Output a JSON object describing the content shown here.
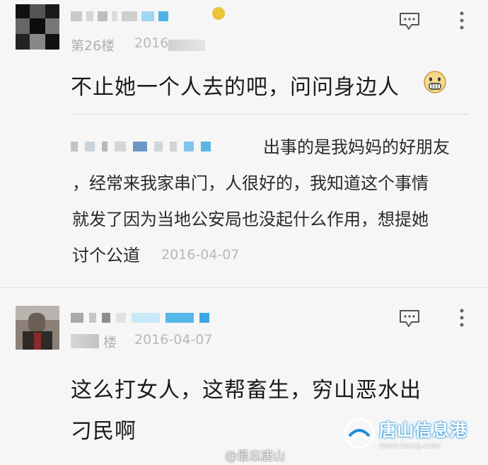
{
  "comment1": {
    "floor": "第26楼",
    "date_partial": "2016",
    "text": "不止她一个人去的吧，问问身边人",
    "emoji": "grimace-emoji"
  },
  "reply": {
    "text": "出事的是我妈妈的好朋友，经常来我家串门，人很好的，我知道这个事情就发了因为当地公安局也没起什么作用，想提她讨个公道",
    "line1": "出事的是我妈妈的好朋友",
    "line2": "，经常来我家串门，人很好的，我知道这个事情",
    "line3": "就发了因为当地公安局也没起什么作用，想提她",
    "line4": "讨个公道",
    "date": "2016-04-07"
  },
  "comment2": {
    "floor_partial": "楼",
    "date": "2016-04-07",
    "line1": "这么打女人，这帮畜生，穷山恶水出",
    "line2": "刁民啊"
  },
  "watermark": {
    "weibo": "@最忘唐山",
    "logo_text": "唐山信息港",
    "logo_url": "www.tsxxg.com"
  },
  "colors": {
    "background": "#f6f6f6",
    "blur_blue": "#4fb3e8",
    "logo_blue": "#1e8fd8"
  }
}
